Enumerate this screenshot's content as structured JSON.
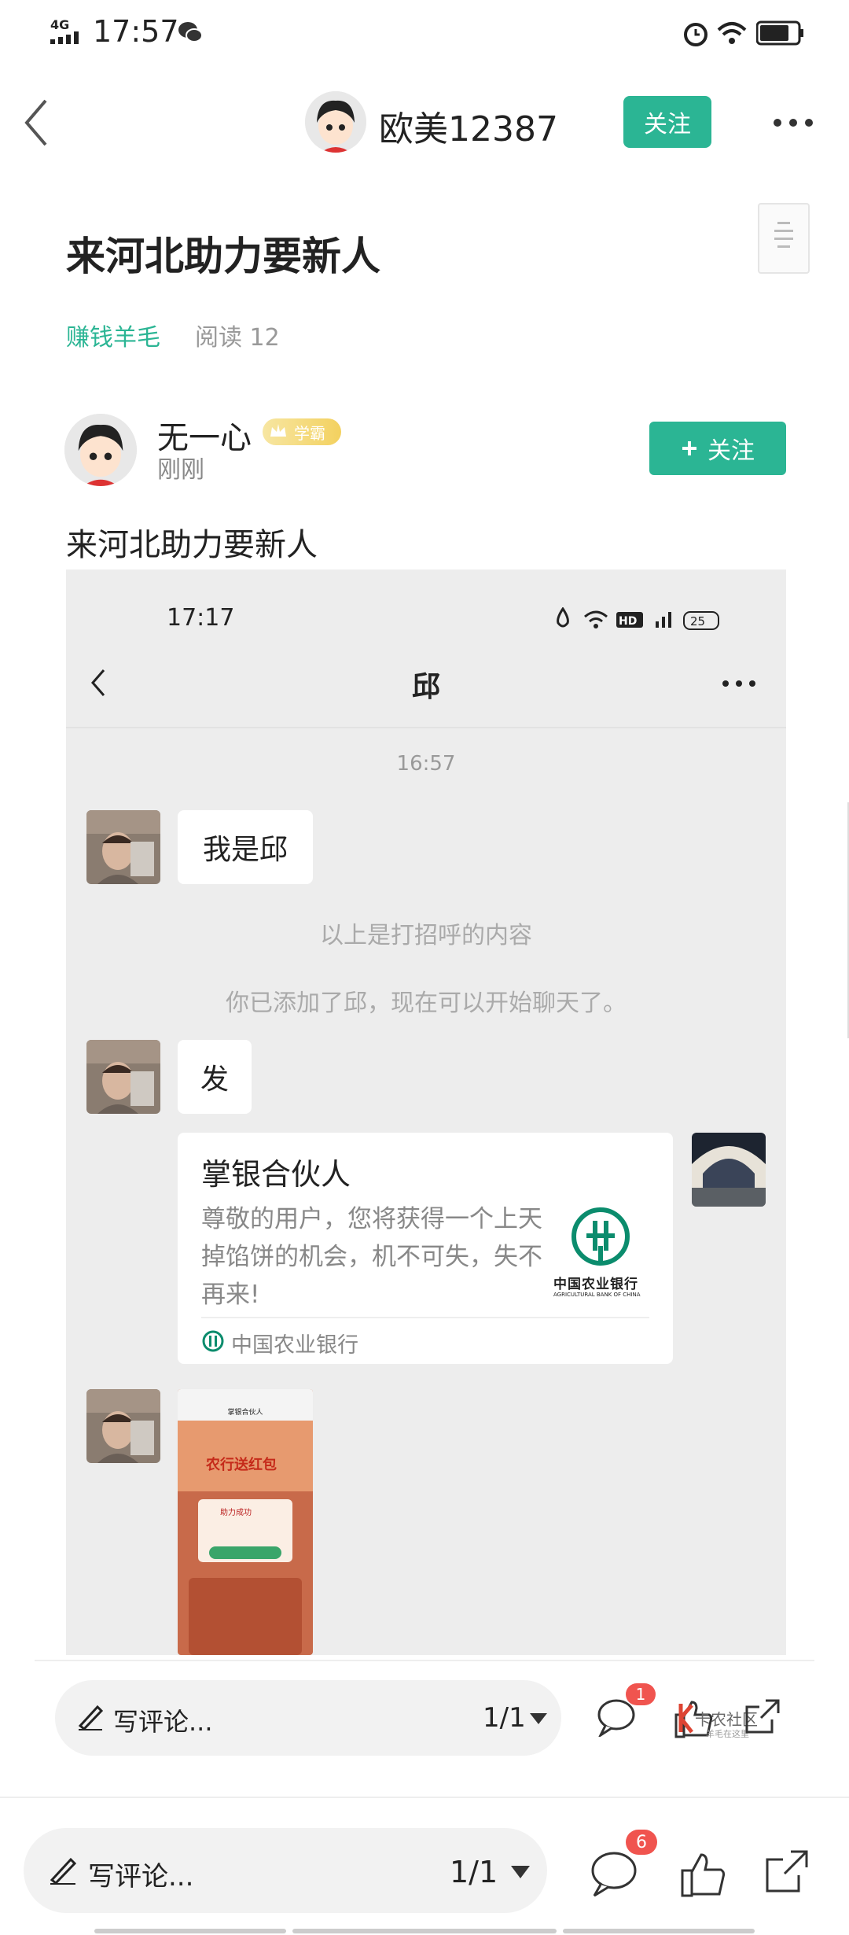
{
  "status_bar": {
    "network": "4G",
    "time": "17:57"
  },
  "header": {
    "username": "欧美12387",
    "follow_label": "关注"
  },
  "post": {
    "title": "来河北助力要新人",
    "tag": "赚钱羊毛",
    "reads": "阅读 12",
    "author": {
      "name": "无一心",
      "badge": "学霸",
      "time": "刚刚",
      "follow_label": "关注"
    },
    "body": "来河北助力要新人"
  },
  "screenshot": {
    "time": "17:17",
    "battery": "25",
    "title": "邱",
    "timestamp": "16:57",
    "messages": {
      "greeting": "我是邱",
      "sys1": "以上是打招呼的内容",
      "sys2": "你已添加了邱，现在可以开始聊天了。",
      "reply": "发"
    },
    "card": {
      "title": "掌银合伙人",
      "desc": "尊敬的用户，您将获得一个上天掉馅饼的机会，机不可失，失不再来!",
      "bank_name": "中国农业银行",
      "bank_en": "AGRICULTURAL BANK OF CHINA",
      "footer": "中国农业银行"
    },
    "image_msg": {
      "top_title": "掌银合伙人",
      "banner": "农行送红包",
      "popup": "助力成功"
    }
  },
  "comment_bar_1": {
    "placeholder": "写评论...",
    "pager": "1/1",
    "comment_count": "1"
  },
  "watermark": {
    "main": "卡农社区",
    "sub": "羊毛在这里"
  },
  "comment_bar_2": {
    "placeholder": "写评论...",
    "pager": "1/1",
    "comment_count": "6"
  }
}
